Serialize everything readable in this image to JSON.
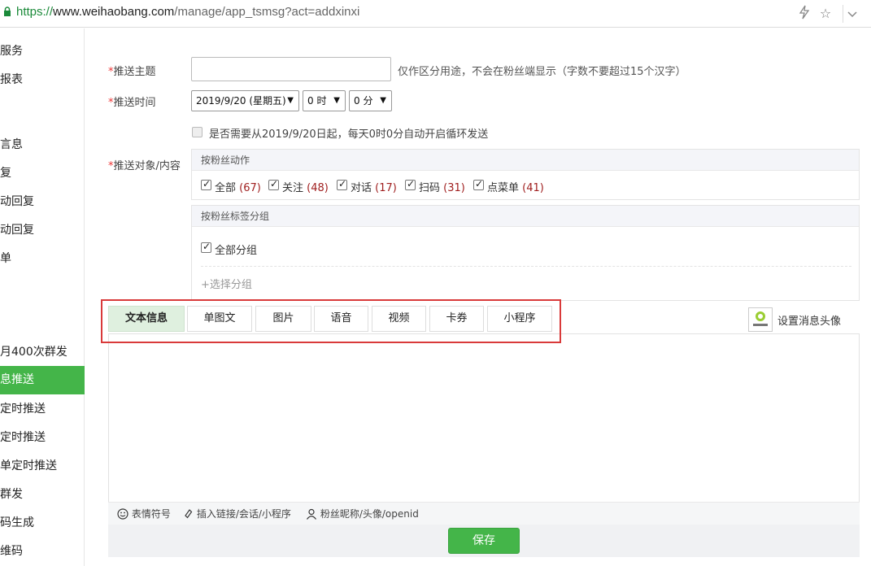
{
  "browser": {
    "url_scheme": "https://",
    "url_host": "www.weihaobang.com",
    "url_path": "/manage/app_tsmsg?act=addxinxi",
    "lightning_icon": "lightning-icon",
    "star_icon": "star-icon",
    "chevron_icon": "chevron-down-icon"
  },
  "sidebar": {
    "items": [
      {
        "label": "服务"
      },
      {
        "label": "报表"
      },
      {
        "label": "言息"
      },
      {
        "label": "复"
      },
      {
        "label": "动回复"
      },
      {
        "label": "动回复"
      },
      {
        "label": "单"
      },
      {
        "label": "月400次群发"
      },
      {
        "label": "息推送"
      },
      {
        "label": "定时推送"
      },
      {
        "label": "定时推送"
      },
      {
        "label": "单定时推送"
      },
      {
        "label": "群发"
      },
      {
        "label": "码生成"
      },
      {
        "label": "维码"
      }
    ],
    "active_color": "#44b549"
  },
  "form": {
    "subject_label": "推送主题",
    "subject_value": "",
    "subject_hint": "仅作区分用途，不会在粉丝端显示（字数不要超过15个汉字）",
    "time_label": "推送时间",
    "date_value": "2019/9/20 (星期五)",
    "hour_value": "0 时",
    "minute_value": "0 分",
    "loop_text": "是否需要从2019/9/20日起，每天0时0分自动开启循环发送",
    "loop_checked": false,
    "target_label": "推送对象/内容",
    "required_mark": "*",
    "actions_panel": {
      "title": "按粉丝动作",
      "options": [
        {
          "label": "全部",
          "count": "(67)"
        },
        {
          "label": "关注",
          "count": "(48)"
        },
        {
          "label": "对话",
          "count": "(17)"
        },
        {
          "label": "扫码",
          "count": "(31)"
        },
        {
          "label": "点菜单",
          "count": "(41)"
        }
      ]
    },
    "groups_panel": {
      "title": "按粉丝标签分组",
      "all_label": "全部分组",
      "add_label": "+选择分组"
    }
  },
  "tabs": [
    {
      "label": "文本信息",
      "active": true
    },
    {
      "label": "单图文"
    },
    {
      "label": "图片"
    },
    {
      "label": "语音"
    },
    {
      "label": "视频"
    },
    {
      "label": "卡券"
    },
    {
      "label": "小程序"
    }
  ],
  "avatar_label": "设置消息头像",
  "editor": {
    "content": "",
    "tools": [
      {
        "icon": "smiley-icon",
        "label": "表情符号"
      },
      {
        "icon": "link-icon",
        "label": "插入链接/会话/小程序"
      },
      {
        "icon": "person-icon",
        "label": "粉丝昵称/头像/openid"
      }
    ]
  },
  "save_label": "保存"
}
